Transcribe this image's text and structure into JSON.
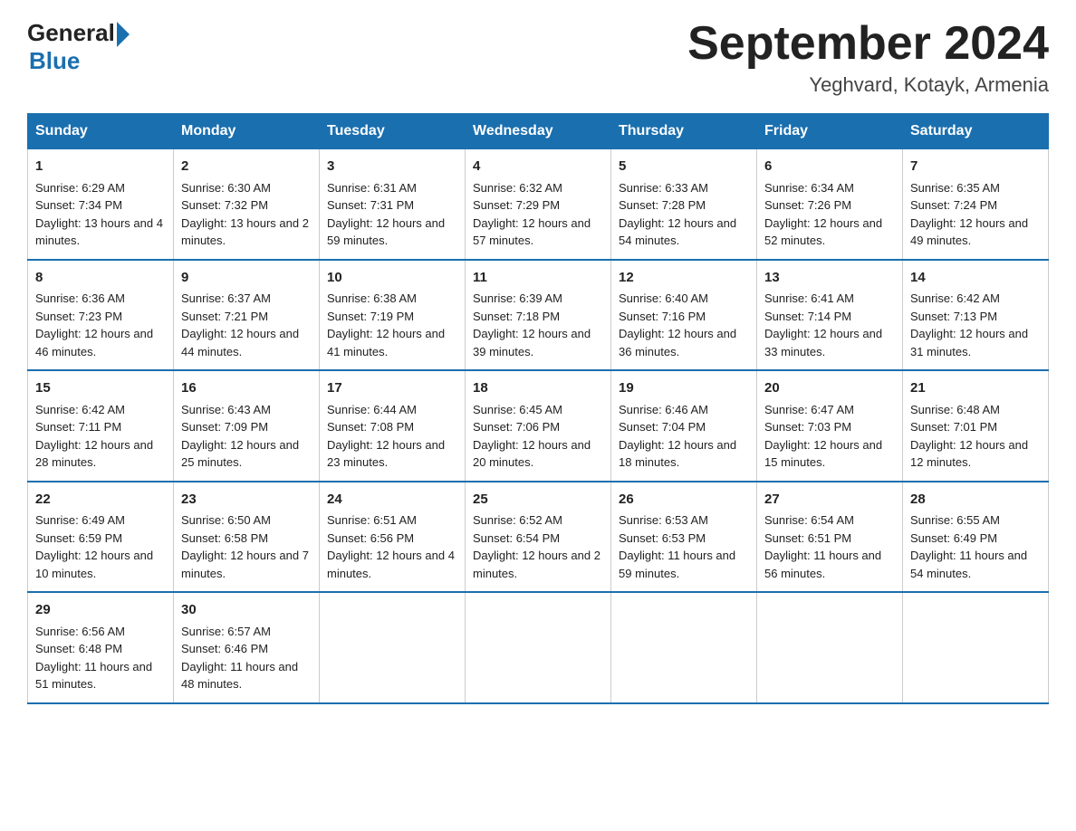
{
  "header": {
    "logo_general": "General",
    "logo_blue": "Blue",
    "month_year": "September 2024",
    "location": "Yeghvard, Kotayk, Armenia"
  },
  "weekdays": [
    "Sunday",
    "Monday",
    "Tuesday",
    "Wednesday",
    "Thursday",
    "Friday",
    "Saturday"
  ],
  "weeks": [
    [
      {
        "day": "1",
        "sunrise": "6:29 AM",
        "sunset": "7:34 PM",
        "daylight": "13 hours and 4 minutes."
      },
      {
        "day": "2",
        "sunrise": "6:30 AM",
        "sunset": "7:32 PM",
        "daylight": "13 hours and 2 minutes."
      },
      {
        "day": "3",
        "sunrise": "6:31 AM",
        "sunset": "7:31 PM",
        "daylight": "12 hours and 59 minutes."
      },
      {
        "day": "4",
        "sunrise": "6:32 AM",
        "sunset": "7:29 PM",
        "daylight": "12 hours and 57 minutes."
      },
      {
        "day": "5",
        "sunrise": "6:33 AM",
        "sunset": "7:28 PM",
        "daylight": "12 hours and 54 minutes."
      },
      {
        "day": "6",
        "sunrise": "6:34 AM",
        "sunset": "7:26 PM",
        "daylight": "12 hours and 52 minutes."
      },
      {
        "day": "7",
        "sunrise": "6:35 AM",
        "sunset": "7:24 PM",
        "daylight": "12 hours and 49 minutes."
      }
    ],
    [
      {
        "day": "8",
        "sunrise": "6:36 AM",
        "sunset": "7:23 PM",
        "daylight": "12 hours and 46 minutes."
      },
      {
        "day": "9",
        "sunrise": "6:37 AM",
        "sunset": "7:21 PM",
        "daylight": "12 hours and 44 minutes."
      },
      {
        "day": "10",
        "sunrise": "6:38 AM",
        "sunset": "7:19 PM",
        "daylight": "12 hours and 41 minutes."
      },
      {
        "day": "11",
        "sunrise": "6:39 AM",
        "sunset": "7:18 PM",
        "daylight": "12 hours and 39 minutes."
      },
      {
        "day": "12",
        "sunrise": "6:40 AM",
        "sunset": "7:16 PM",
        "daylight": "12 hours and 36 minutes."
      },
      {
        "day": "13",
        "sunrise": "6:41 AM",
        "sunset": "7:14 PM",
        "daylight": "12 hours and 33 minutes."
      },
      {
        "day": "14",
        "sunrise": "6:42 AM",
        "sunset": "7:13 PM",
        "daylight": "12 hours and 31 minutes."
      }
    ],
    [
      {
        "day": "15",
        "sunrise": "6:42 AM",
        "sunset": "7:11 PM",
        "daylight": "12 hours and 28 minutes."
      },
      {
        "day": "16",
        "sunrise": "6:43 AM",
        "sunset": "7:09 PM",
        "daylight": "12 hours and 25 minutes."
      },
      {
        "day": "17",
        "sunrise": "6:44 AM",
        "sunset": "7:08 PM",
        "daylight": "12 hours and 23 minutes."
      },
      {
        "day": "18",
        "sunrise": "6:45 AM",
        "sunset": "7:06 PM",
        "daylight": "12 hours and 20 minutes."
      },
      {
        "day": "19",
        "sunrise": "6:46 AM",
        "sunset": "7:04 PM",
        "daylight": "12 hours and 18 minutes."
      },
      {
        "day": "20",
        "sunrise": "6:47 AM",
        "sunset": "7:03 PM",
        "daylight": "12 hours and 15 minutes."
      },
      {
        "day": "21",
        "sunrise": "6:48 AM",
        "sunset": "7:01 PM",
        "daylight": "12 hours and 12 minutes."
      }
    ],
    [
      {
        "day": "22",
        "sunrise": "6:49 AM",
        "sunset": "6:59 PM",
        "daylight": "12 hours and 10 minutes."
      },
      {
        "day": "23",
        "sunrise": "6:50 AM",
        "sunset": "6:58 PM",
        "daylight": "12 hours and 7 minutes."
      },
      {
        "day": "24",
        "sunrise": "6:51 AM",
        "sunset": "6:56 PM",
        "daylight": "12 hours and 4 minutes."
      },
      {
        "day": "25",
        "sunrise": "6:52 AM",
        "sunset": "6:54 PM",
        "daylight": "12 hours and 2 minutes."
      },
      {
        "day": "26",
        "sunrise": "6:53 AM",
        "sunset": "6:53 PM",
        "daylight": "11 hours and 59 minutes."
      },
      {
        "day": "27",
        "sunrise": "6:54 AM",
        "sunset": "6:51 PM",
        "daylight": "11 hours and 56 minutes."
      },
      {
        "day": "28",
        "sunrise": "6:55 AM",
        "sunset": "6:49 PM",
        "daylight": "11 hours and 54 minutes."
      }
    ],
    [
      {
        "day": "29",
        "sunrise": "6:56 AM",
        "sunset": "6:48 PM",
        "daylight": "11 hours and 51 minutes."
      },
      {
        "day": "30",
        "sunrise": "6:57 AM",
        "sunset": "6:46 PM",
        "daylight": "11 hours and 48 minutes."
      },
      null,
      null,
      null,
      null,
      null
    ]
  ]
}
